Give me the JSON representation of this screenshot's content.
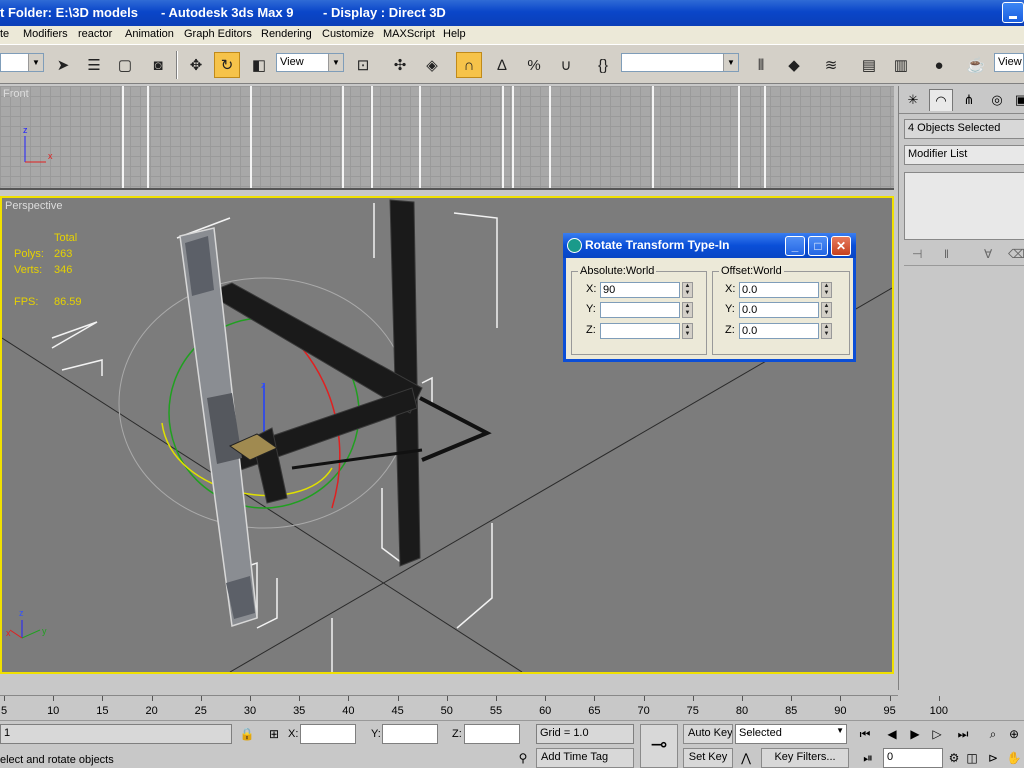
{
  "window": {
    "title_folder": "t Folder: E:\\3D models",
    "title_app": "- Autodesk 3ds Max 9",
    "title_display": "- Display : Direct 3D"
  },
  "menu": [
    "te",
    "Modifiers",
    "reactor",
    "Animation",
    "Graph Editors",
    "Rendering",
    "Customize",
    "MAXScript",
    "Help"
  ],
  "toolbar": {
    "reference_coord": "View",
    "named_selection": "",
    "right_view": "View"
  },
  "viewports": {
    "front_label": "Front",
    "persp_label": "Perspective",
    "axis_z": "z",
    "axis_x": "x",
    "axis_y": "y"
  },
  "stats": {
    "total_label": "Total",
    "polys_label": "Polys:",
    "polys_value": "263",
    "verts_label": "Verts:",
    "verts_value": "346",
    "fps_label": "FPS:",
    "fps_value": "86.59"
  },
  "dialog": {
    "title": "Rotate Transform Type-In",
    "absolute_title": "Absolute:World",
    "offset_title": "Offset:World",
    "abs_x_label": "X:",
    "abs_y_label": "Y:",
    "abs_z_label": "Z:",
    "abs_x": "90",
    "abs_y": "",
    "abs_z": "",
    "off_x_label": "X:",
    "off_y_label": "Y:",
    "off_z_label": "Z:",
    "off_x": "0.0",
    "off_y": "0.0",
    "off_z": "0.0"
  },
  "command_panel": {
    "selection_name": "4 Objects Selected",
    "modifier_list": "Modifier List"
  },
  "timeline": {
    "ticks": [
      "5",
      "10",
      "15",
      "20",
      "25",
      "30",
      "35",
      "40",
      "45",
      "50",
      "55",
      "60",
      "65",
      "70",
      "75",
      "80",
      "85",
      "90",
      "95",
      "100"
    ]
  },
  "statusbar": {
    "prompt_top": "1",
    "prompt_bottom": "elect and rotate objects",
    "x_label": "X:",
    "y_label": "Y:",
    "z_label": "Z:",
    "x_value": "",
    "y_value": "",
    "z_value": "",
    "grid": "Grid = 1.0",
    "add_time_tag": "Add Time Tag",
    "auto_key": "Auto Key",
    "set_key": "Set Key",
    "key_mode": "Selected",
    "key_filters": "Key Filters...",
    "current_frame": "0"
  }
}
